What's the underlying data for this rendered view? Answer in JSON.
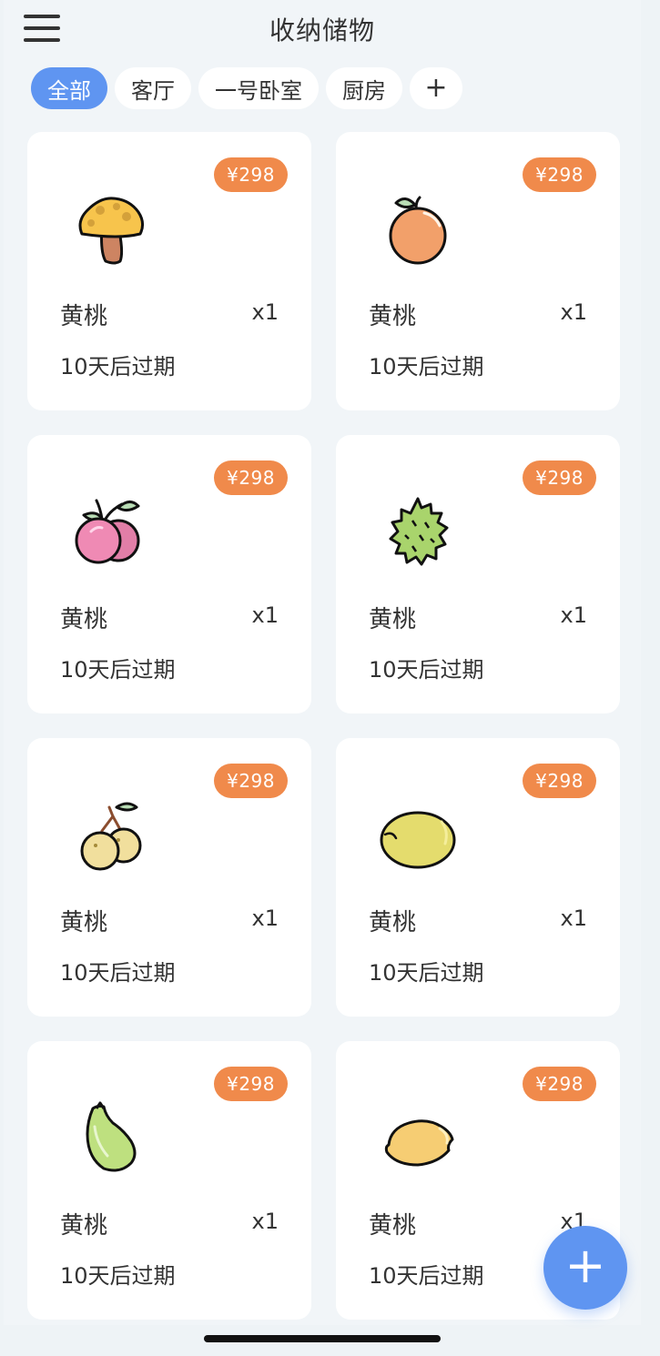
{
  "header": {
    "title": "收纳储物"
  },
  "tabs": [
    {
      "label": "全部",
      "active": true
    },
    {
      "label": "客厅",
      "active": false
    },
    {
      "label": "一号卧室",
      "active": false
    },
    {
      "label": "厨房",
      "active": false
    },
    {
      "label": "+",
      "active": false
    }
  ],
  "items": [
    {
      "name": "黄桃",
      "qty": "x1",
      "price": "¥298",
      "expire": "10天后过期",
      "icon": "mushroom-icon"
    },
    {
      "name": "黄桃",
      "qty": "x1",
      "price": "¥298",
      "expire": "10天后过期",
      "icon": "orange-icon"
    },
    {
      "name": "黄桃",
      "qty": "x1",
      "price": "¥298",
      "expire": "10天后过期",
      "icon": "plum-icon"
    },
    {
      "name": "黄桃",
      "qty": "x1",
      "price": "¥298",
      "expire": "10天后过期",
      "icon": "durian-icon"
    },
    {
      "name": "黄桃",
      "qty": "x1",
      "price": "¥298",
      "expire": "10天后过期",
      "icon": "longan-icon"
    },
    {
      "name": "黄桃",
      "qty": "x1",
      "price": "¥298",
      "expire": "10天后过期",
      "icon": "melon-icon"
    },
    {
      "name": "黄桃",
      "qty": "x1",
      "price": "¥298",
      "expire": "10天后过期",
      "icon": "papaya-icon"
    },
    {
      "name": "黄桃",
      "qty": "x1",
      "price": "¥298",
      "expire": "10天后过期",
      "icon": "lemon-icon"
    }
  ],
  "fab": {
    "label": "+"
  },
  "colors": {
    "accent": "#5f95f1",
    "price_badge": "#f08a4b",
    "background": "#f1f5f8",
    "card": "#ffffff"
  }
}
